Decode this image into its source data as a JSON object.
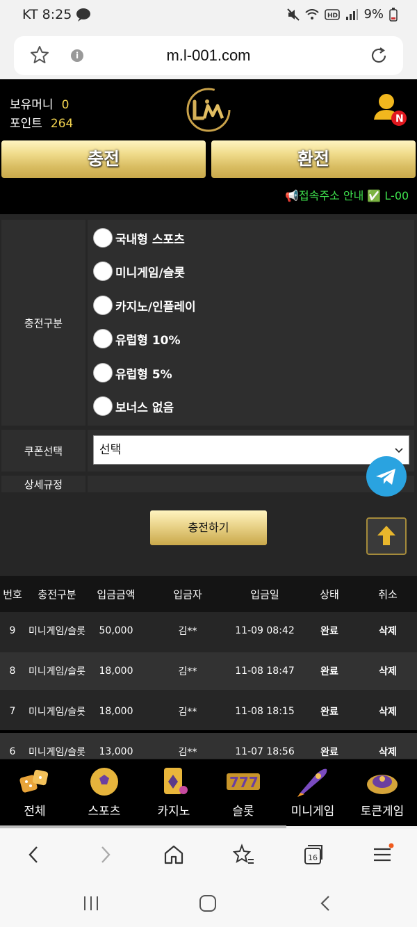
{
  "status_bar": {
    "carrier_time": "KT 8:25",
    "battery": "9%"
  },
  "browser": {
    "url": "m.l-001.com",
    "tab_count": "16"
  },
  "header": {
    "money_label": "보유머니",
    "money_value": "0",
    "point_label": "포인트",
    "point_value": "264",
    "user_badge": "N"
  },
  "actions": {
    "charge": "충전",
    "exchange": "환전"
  },
  "notice": "📢접속주소 안내 ✅ L-00",
  "form": {
    "type_label": "충전구분",
    "options": [
      "국내형 스포츠",
      "미니게임/슬롯",
      "카지노/인플레이",
      "유럽형 10%",
      "유럽형 5%",
      "보너스 없음"
    ],
    "coupon_label": "쿠폰선택",
    "coupon_value": "선택",
    "rules_label": "상세규정",
    "submit": "충전하기"
  },
  "table": {
    "headers": [
      "번호",
      "충전구분",
      "입금금액",
      "입금자",
      "입금일",
      "상태",
      "취소"
    ],
    "rows": [
      [
        "9",
        "미니게임/슬롯",
        "50,000",
        "김**",
        "11-09 08:42",
        "완료",
        "삭제"
      ],
      [
        "8",
        "미니게임/슬롯",
        "18,000",
        "김**",
        "11-08 18:47",
        "완료",
        "삭제"
      ],
      [
        "7",
        "미니게임/슬롯",
        "18,000",
        "김**",
        "11-08 18:15",
        "완료",
        "삭제"
      ],
      [
        "6",
        "미니게임/슬롯",
        "13,000",
        "김**",
        "11-07 18:56",
        "완료",
        "삭제"
      ]
    ]
  },
  "bottom_nav": [
    "전체",
    "스포츠",
    "카지노",
    "슬롯",
    "미니게임",
    "토큰게임"
  ],
  "colors": {
    "gold": "#d9bd62",
    "notice_green": "#3ee04d",
    "money_yellow": "#f2d34f"
  }
}
